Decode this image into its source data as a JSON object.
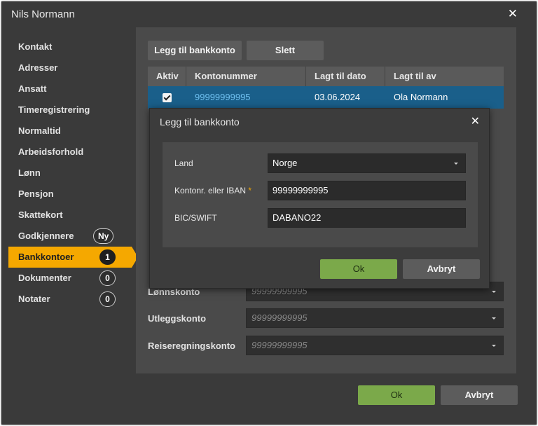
{
  "window": {
    "title": "Nils Normann",
    "close_icon": "close-icon"
  },
  "sidebar": {
    "items": [
      {
        "label": "Kontakt",
        "badge": null
      },
      {
        "label": "Adresser",
        "badge": null
      },
      {
        "label": "Ansatt",
        "badge": null
      },
      {
        "label": "Timeregistrering",
        "badge": null
      },
      {
        "label": "Normaltid",
        "badge": null
      },
      {
        "label": "Arbeidsforhold",
        "badge": null
      },
      {
        "label": "Lønn",
        "badge": null
      },
      {
        "label": "Pensjon",
        "badge": null
      },
      {
        "label": "Skattekort",
        "badge": null
      },
      {
        "label": "Godkjennere",
        "badge": "Ny"
      },
      {
        "label": "Bankkontoer",
        "badge": "1",
        "active": true
      },
      {
        "label": "Dokumenter",
        "badge": "0"
      },
      {
        "label": "Notater",
        "badge": "0"
      }
    ]
  },
  "toolbar": {
    "add_label": "Legg til bankkonto",
    "delete_label": "Slett"
  },
  "table": {
    "headers": [
      "Aktiv",
      "Kontonummer",
      "Lagt til dato",
      "Lagt til av"
    ],
    "rows": [
      {
        "active": true,
        "account": "99999999995",
        "date": "03.06.2024",
        "added_by": "Ola Normann"
      }
    ]
  },
  "accounts": {
    "lonn": {
      "label": "Lønnskonto",
      "placeholder": "99999999995"
    },
    "utlegg": {
      "label": "Utleggskonto",
      "placeholder": "99999999995"
    },
    "reise": {
      "label": "Reiseregningskonto",
      "placeholder": "99999999995"
    }
  },
  "modal": {
    "title": "Legg til bankkonto",
    "country_label": "Land",
    "country_value": "Norge",
    "account_label": "Kontonr. eller IBAN",
    "required_mark": "*",
    "account_value": "99999999995",
    "bic_label": "BIC/SWIFT",
    "bic_value": "DABANO22",
    "ok_label": "Ok",
    "cancel_label": "Avbryt"
  },
  "footer": {
    "ok_label": "Ok",
    "cancel_label": "Avbryt"
  },
  "colors": {
    "accent": "#f5a800",
    "selected_row": "#1a5f8a",
    "ok_button": "#7ba94a"
  }
}
